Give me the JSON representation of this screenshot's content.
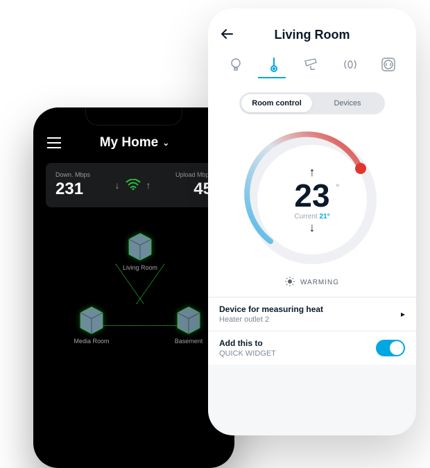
{
  "dark": {
    "title": "My Home",
    "down_label": "Down. Mbps",
    "down_value": "231",
    "up_label": "Upload Mbps",
    "up_value": "45",
    "nodes": {
      "top": "Living Room",
      "left": "Media Room",
      "right": "Basement"
    }
  },
  "light": {
    "title": "Living Room",
    "tabs": {
      "room": "Room control",
      "devices": "Devices"
    },
    "target_temp": "23",
    "current_label": "Current",
    "current_value": "21",
    "status": "WARMING",
    "row1": {
      "label": "Device for measuring heat",
      "sub": "Heater outlet 2"
    },
    "row2": {
      "label": "Add this to",
      "sub": "QUICK WIDGET"
    }
  }
}
